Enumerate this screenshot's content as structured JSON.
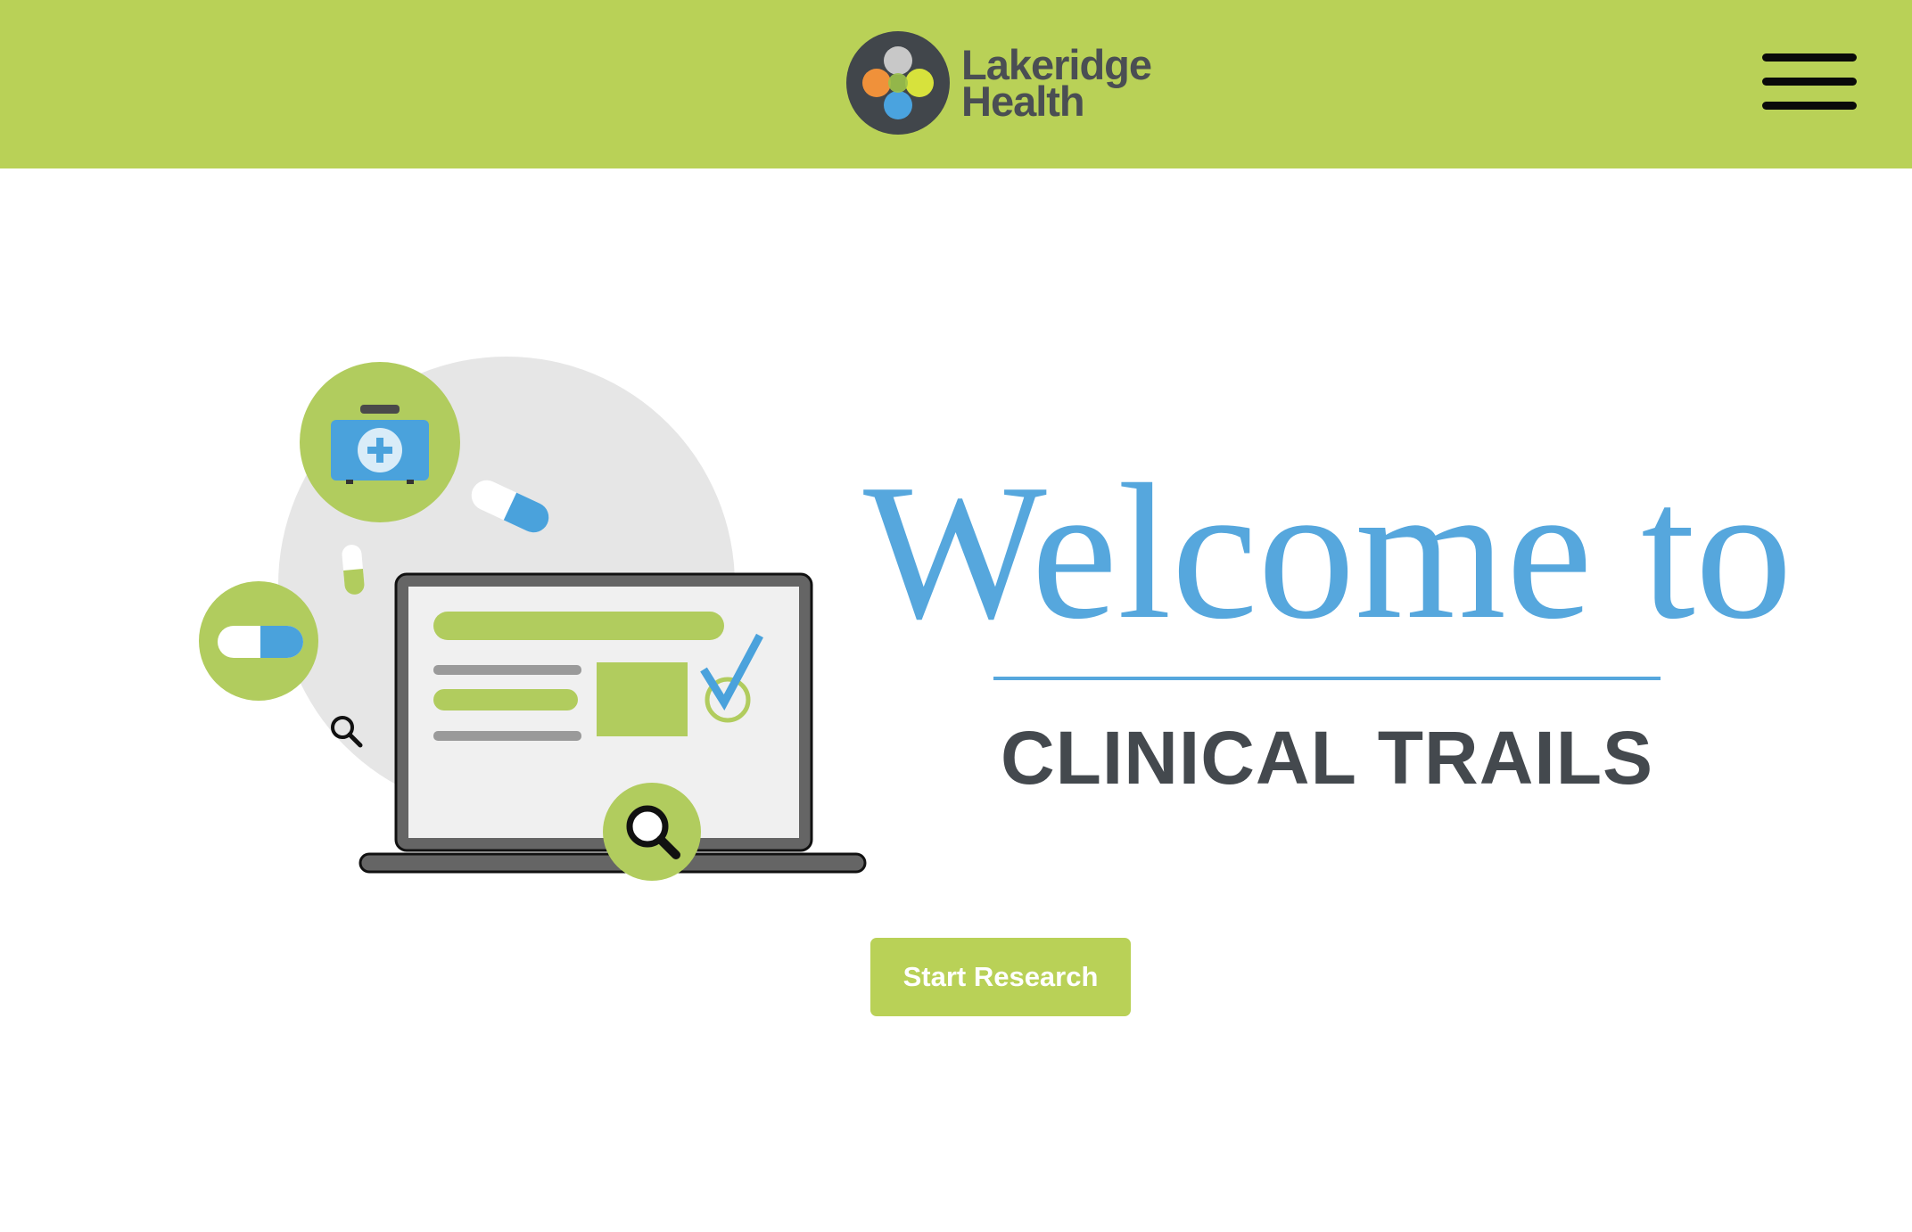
{
  "colors": {
    "header_bg": "#b9d157",
    "accent_green": "#b9d157",
    "accent_blue": "#56a7dd",
    "title_gray": "#44494e",
    "logo_gray": "#4a4e53"
  },
  "header": {
    "logo": {
      "line1": "Lakeridge",
      "line2": "Health"
    },
    "menu_icon": "hamburger-menu-icon"
  },
  "hero": {
    "welcome": "Welcome to",
    "subtitle": "CLINICAL TRAILS",
    "cta_label": "Start Research"
  },
  "illustration_icons": [
    "medical-kit-icon",
    "pill-icon",
    "laptop-icon",
    "checkmark-icon",
    "magnifier-icon"
  ]
}
